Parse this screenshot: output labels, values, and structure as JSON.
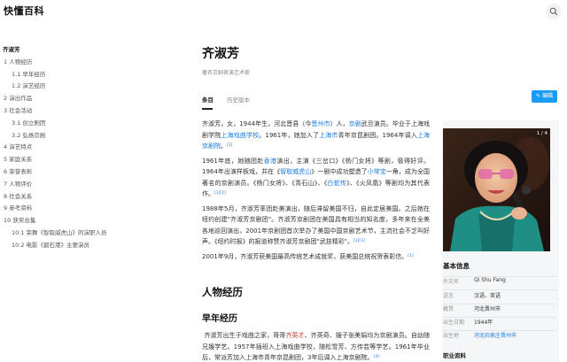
{
  "header": {
    "logo": "快懂百科"
  },
  "toc": [
    {
      "label": "齐淑芳",
      "level": 0
    },
    {
      "label": "1  人物经历",
      "level": 1
    },
    {
      "label": "1.1  早年经历",
      "level": 2
    },
    {
      "label": "1.2  演艺经历",
      "level": 2
    },
    {
      "label": "2  演出作品",
      "level": 1
    },
    {
      "label": "3  社会活动",
      "level": 1
    },
    {
      "label": "3.1  创立剧团",
      "level": 2
    },
    {
      "label": "3.2  弘扬京剧",
      "level": 2
    },
    {
      "label": "4  演艺特点",
      "level": 1
    },
    {
      "label": "5  家庭关系",
      "level": 1
    },
    {
      "label": "6  荣誉表彰",
      "level": 1
    },
    {
      "label": "7  人物评价",
      "level": 1
    },
    {
      "label": "8  社会关系",
      "level": 1
    },
    {
      "label": "9  参考资料",
      "level": 1
    },
    {
      "label": "10  获奖合集",
      "level": 1
    },
    {
      "label": "10.1 荣舞《智取威虎山》的演职人员",
      "level": 2
    },
    {
      "label": "10.2 电影《碧石港》主要演员",
      "level": 2
    }
  ],
  "page": {
    "title": "齐淑芳",
    "subtitle": "著名京剧表演艺术家",
    "tabs": [
      "条目",
      "历史版本"
    ],
    "edit_label": "编辑"
  },
  "paragraphs": {
    "p1": {
      "a": "齐淑芳，女，1944年生，河北晋县（今",
      "l1": "晋州市",
      "b": "）人，",
      "l2": "京剧",
      "c": "武旦演员。毕业于上海戏剧学院",
      "l3": "上海戏曲学校",
      "d": "。1961年，她加入了",
      "l4": "上海市",
      "e": "青年京昆剧团。1964年调入",
      "l5": "上海京剧院",
      "f": "。",
      "cite": "[1]"
    },
    "p2": {
      "a": "1961年底，她随团赴",
      "l1": "香港",
      "b": "演出，主演《三岔口》《杨门女将》等剧，极得好评。1964年出演样板戏，并在《",
      "l2": "智取威虎山",
      "c": "》一剧中成功塑造了",
      "l3": "小常宝",
      "d": "一角，成为全国著名的京剧演员。《杨门女将》、《青石山》、《",
      "l4": "白蛇传",
      "e": "》、《火凤凰》等剧均为其代表作。",
      "cite": "[1][2]"
    },
    "p3": {
      "a": "1988年5月，齐淑芳率团赴美演出，随后滞留美国不归，自此定居美国。之后她在纽约创建\"齐淑芳京剧团\"。齐淑芳京剧团在美国具有相当的知名度，多年来在全美各地巡回演出，2001年京剧团首次举办了美国中国京剧艺术节，主流社会不乏叫好声。《纽约时报》的报道称赞齐淑芳京剧团\"武技精彩\"。",
      "cite": "[1][3]"
    },
    "p4": {
      "a": "2001年9月，齐淑芳获美国最高传统艺术成就奖，获美国总统祝贺表彰信。",
      "cite": "[1]"
    }
  },
  "sections": {
    "h2": "人物经历",
    "h3": "早年经历",
    "p5": {
      "a": "齐淑芳出生于戏曲之家，哥哥",
      "l1": "齐英才",
      "b": "、齐英奇、嫂子张美娟均为京剧演员。自幼随兄嫂学艺。1957年插班入上海戏曲学校，随松雪芳、方传芸等学艺。1961年毕业后，常派芳加入上海市青年京昆剧团，3年后调入上海京剧院。",
      "cite": "[4]"
    }
  },
  "infobox": {
    "counter": "1 / 4",
    "title": "基本信息",
    "rows": [
      {
        "label": "外文名",
        "value": "Qi Shu Fang"
      },
      {
        "label": "语言",
        "value": "汉语、英语"
      },
      {
        "label": "籍贯",
        "value": "河北晋州市"
      },
      {
        "label": "出生日期",
        "value": "1944年"
      },
      {
        "label": "出生地",
        "value": "河北石家庄晋州市"
      }
    ],
    "footer": "职业资料"
  }
}
